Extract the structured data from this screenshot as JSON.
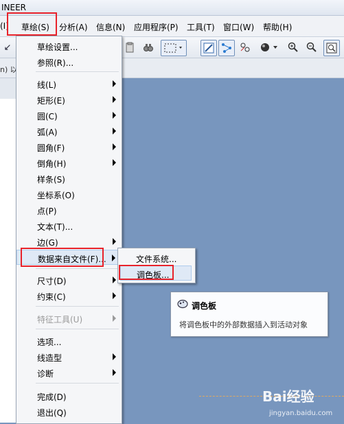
{
  "titlebar": {
    "title": "INEER"
  },
  "menubar": {
    "items": [
      {
        "label": "(I)"
      },
      {
        "label": "草绘(S)"
      },
      {
        "label": "分析(A)"
      },
      {
        "label": "信息(N)"
      },
      {
        "label": "应用程序(P)"
      },
      {
        "label": "工具(T)"
      },
      {
        "label": "窗口(W)"
      },
      {
        "label": "帮助(H)"
      }
    ]
  },
  "strip2": {
    "note": "n) 以产"
  },
  "sketch_menu": {
    "items": [
      {
        "label": "草绘设置..."
      },
      {
        "label": "参照(R)..."
      },
      {
        "label": "线(L)"
      },
      {
        "label": "矩形(E)"
      },
      {
        "label": "圆(C)"
      },
      {
        "label": "弧(A)"
      },
      {
        "label": "圆角(F)"
      },
      {
        "label": "倒角(H)"
      },
      {
        "label": "样条(S)"
      },
      {
        "label": "坐标系(O)"
      },
      {
        "label": "点(P)"
      },
      {
        "label": "文本(T)..."
      },
      {
        "label": "边(G)"
      },
      {
        "label": "数据来自文件(F)..."
      },
      {
        "label": "尺寸(D)"
      },
      {
        "label": "约束(C)"
      },
      {
        "label": "特征工具(U)"
      },
      {
        "label": "选项..."
      },
      {
        "label": "线造型"
      },
      {
        "label": "诊断"
      },
      {
        "label": "完成(D)"
      },
      {
        "label": "退出(Q)"
      }
    ]
  },
  "submenu": {
    "items": [
      {
        "label": "文件系统..."
      },
      {
        "label": "调色板..."
      }
    ]
  },
  "tooltip": {
    "title": "调色板",
    "description": "将调色板中的外部数据插入到活动对象"
  },
  "watermark": {
    "brand": "Bai经验",
    "site": "jingyan.baidu.com"
  },
  "colors": {
    "highlight_box": "#e8222a",
    "canvas": "#7896be"
  }
}
